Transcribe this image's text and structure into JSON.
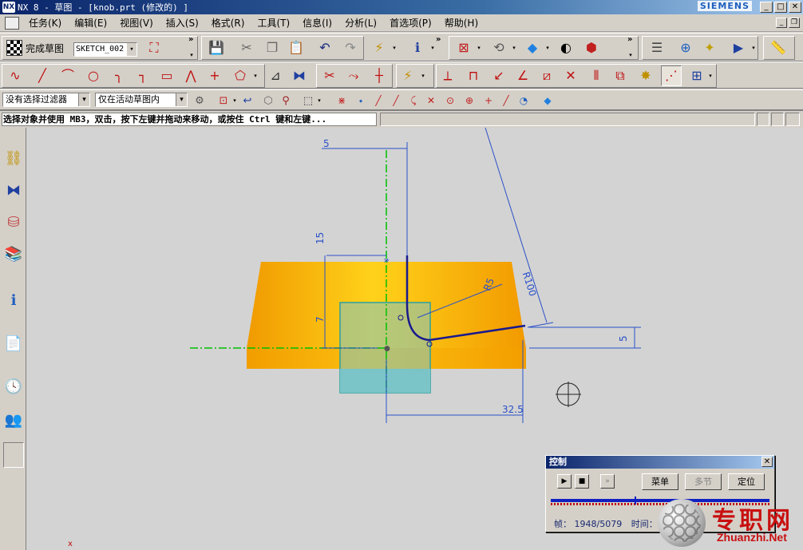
{
  "window": {
    "title": "NX 8 - 草图 - [knob.prt (修改的) ]",
    "brand": "SIEMENS"
  },
  "menubar": {
    "items": [
      "任务(K)",
      "编辑(E)",
      "视图(V)",
      "插入(S)",
      "格式(R)",
      "工具(T)",
      "信息(I)",
      "分析(L)",
      "首选项(P)",
      "帮助(H)"
    ]
  },
  "toolbar": {
    "finish_sketch_label": "完成草图",
    "sketch_name": "SKETCH_002",
    "more_glyph": "»"
  },
  "selection_bar": {
    "filter_value": "没有选择过滤器",
    "scope_value": "仅在活动草图内"
  },
  "cue_line": {
    "text": "选择对象并使用 MB3，双击，按下左键并拖动来移动，或按住 Ctrl 键和左键..."
  },
  "sketch": {
    "dimensions": [
      "5",
      "15",
      "7",
      "R5",
      "R100",
      "5",
      "32.5"
    ],
    "colors": {
      "background": "#d3d3d3",
      "part_orange": "#f5a300",
      "dimension_blue": "#2a50c8",
      "curve_navy": "#1a1a8c",
      "centerline_green": "#00c000",
      "rect_teal": "#2aa0a0"
    }
  },
  "control_panel": {
    "title": "控制",
    "buttons": {
      "menu": "菜单",
      "multi": "多节",
      "locate": "定位"
    },
    "frame_label": "帧：",
    "frame_value": "1948/5079",
    "time_label": "时间："
  },
  "watermark": {
    "cn": "专职网",
    "en": "Zhuanzhi.Net"
  }
}
